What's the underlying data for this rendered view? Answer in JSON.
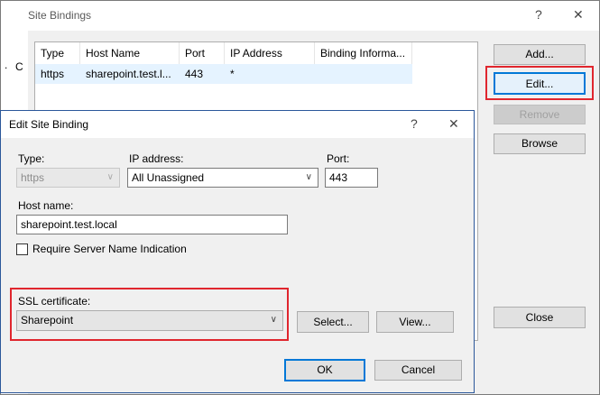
{
  "outer": {
    "title": "Site Bindings",
    "help_glyph": "?",
    "close_glyph": "✕",
    "left_fragment_dot": ".",
    "left_fragment_c": "C",
    "columns": [
      "Type",
      "Host Name",
      "Port",
      "IP Address",
      "Binding Informa..."
    ],
    "rows": [
      {
        "type": "https",
        "host": "sharepoint.test.l...",
        "port": "443",
        "ip": "*",
        "info": ""
      }
    ],
    "buttons": {
      "add": "Add...",
      "edit": "Edit...",
      "remove": "Remove",
      "browse": "Browse",
      "close": "Close"
    }
  },
  "dialog": {
    "title": "Edit Site Binding",
    "help_glyph": "?",
    "close_glyph": "✕",
    "type_label": "Type:",
    "type_value": "https",
    "ip_label": "IP address:",
    "ip_value": "All Unassigned",
    "port_label": "Port:",
    "port_value": "443",
    "host_label": "Host name:",
    "host_value": "sharepoint.test.local",
    "sni_label": "Require Server Name Indication",
    "sni_checked": false,
    "ssl_label": "SSL certificate:",
    "ssl_value": "Sharepoint",
    "select_button": "Select...",
    "view_button": "View...",
    "ok_button": "OK",
    "cancel_button": "Cancel"
  },
  "colors": {
    "highlight": "#e0262e",
    "focus": "#0078d7"
  }
}
